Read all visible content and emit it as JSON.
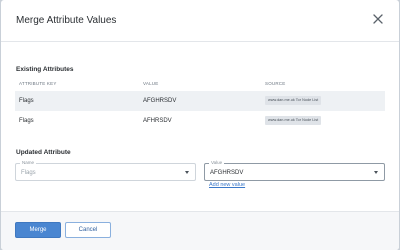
{
  "dialog": {
    "title": "Merge Attribute Values"
  },
  "existing": {
    "heading": "Existing Attributes",
    "columns": {
      "key": "ATTRIBUTE KEY",
      "value": "VALUE",
      "source": "SOURCE"
    },
    "rows": [
      {
        "key": "Flags",
        "value": "AFGHRSDV",
        "source": "www.dan.me.uk Tor Node List"
      },
      {
        "key": "Flags",
        "value": "AFHRSDV",
        "source": "www.dan.me.uk Tor Node List"
      }
    ]
  },
  "updated": {
    "heading": "Updated Attribute",
    "name_field": {
      "label": "Name",
      "value": "Flags"
    },
    "value_field": {
      "label": "Value",
      "value": "AFGHRSDV"
    },
    "add_link": "Add new value"
  },
  "footer": {
    "merge_label": "Merge",
    "cancel_label": "Cancel"
  },
  "icons": {
    "close": "close-icon",
    "dropdown": "chevron-down-icon"
  },
  "colors": {
    "primary": "#4a86d1",
    "link": "#3a78c9",
    "row_shade": "#eef1f4"
  }
}
